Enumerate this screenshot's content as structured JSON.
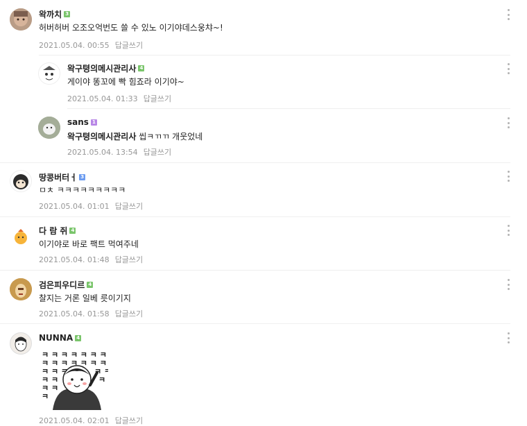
{
  "colors": {
    "badge_green": "#7ac56b",
    "badge_blue": "#6c9cf0",
    "badge_purple": "#b887e6",
    "meta_gray": "#979797",
    "divider": "#efefef"
  },
  "comments": [
    {
      "nick": "왁까치",
      "badge": "3",
      "text": "허버허버 오조오억번도 쓸 수 있노 이기야데스웅챠~!",
      "date": "2021.05.04. 00:55",
      "reply_label": "답글쓰기"
    },
    {
      "nick": "왁구텽의메시관리사",
      "badge": "4",
      "text": "게이야 똥꼬에 빡 힘죠라 이기야~",
      "date": "2021.05.04. 01:33",
      "reply_label": "답글쓰기"
    },
    {
      "nick": "sans",
      "badge": "1",
      "mention": "왁구텽의메시관리사",
      "text": " 씹ㅋㄲㄲ 개웃었네",
      "date": "2021.05.04. 13:54",
      "reply_label": "답글쓰기"
    },
    {
      "nick": "땅콩버터ㅓ",
      "badge": "3",
      "text": "ㅁㅊ ㅋㅋㅋㅋㅋㅋㅋㅋㅋ",
      "date": "2021.05.04. 01:01",
      "reply_label": "답글쓰기"
    },
    {
      "nick": "다 람 쥐",
      "badge": "4",
      "text": "이기야로 바로 팩트 먹여주네",
      "date": "2021.05.04. 01:48",
      "reply_label": "답글쓰기"
    },
    {
      "nick": "검은피우디르",
      "badge": "4",
      "text": "찰지는 거론 일베 릇이기지",
      "date": "2021.05.04. 01:58",
      "reply_label": "답글쓰기"
    },
    {
      "nick": "NUNNA",
      "badge": "4",
      "text": "",
      "date": "2021.05.04. 02:01",
      "reply_label": "답글쓰기"
    }
  ],
  "sticker_text": "ㅋ"
}
